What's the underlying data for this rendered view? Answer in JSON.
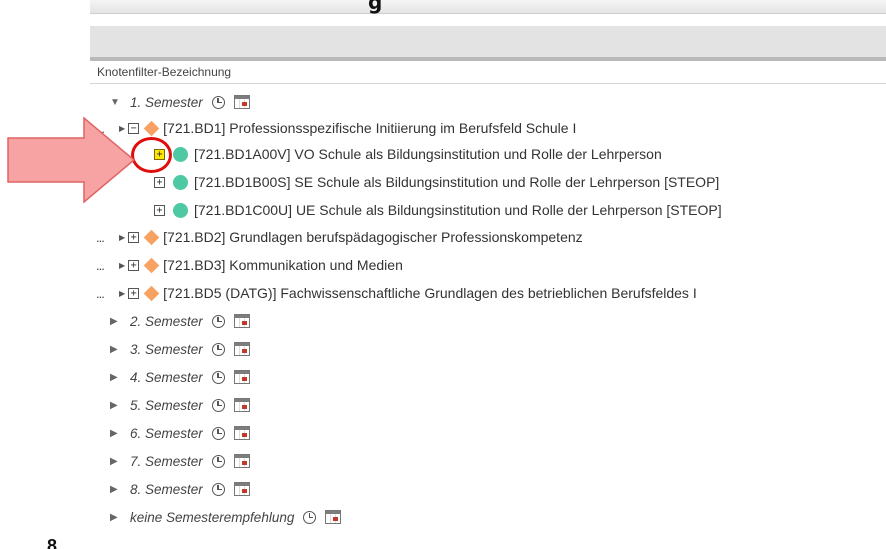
{
  "header": {
    "title_fragment": "g",
    "column_label": "Knotenfilter-Bezeichnung"
  },
  "tree": {
    "open_semester": {
      "label": "1. Semester",
      "expanded": true
    },
    "modules": [
      {
        "code": "[721.BD1] Professionsspezifische Initiierung im Berufsfeld Schule I",
        "prefix": "...",
        "toggle": "−",
        "expanded": true
      },
      {
        "code": "[721.BD2] Grundlagen berufspädagogischer Professionskompetenz",
        "prefix": "...",
        "toggle": "+"
      },
      {
        "code": "[721.BD3] Kommunikation und Medien",
        "prefix": "...",
        "toggle": "+"
      },
      {
        "code": "[721.BD5 (DATG)] Fachwissenschaftliche Grundlagen des betrieblichen Berufsfeldes I",
        "prefix": "...",
        "toggle": "+"
      }
    ],
    "courses": [
      {
        "label": "[721.BD1A00V] VO Schule als Bildungsinstitution und Rolle der Lehrperson",
        "toggle": "+",
        "highlighted": true
      },
      {
        "label": "[721.BD1B00S] SE Schule als Bildungsinstitution und Rolle der Lehrperson [STEOP]",
        "toggle": "+"
      },
      {
        "label": "[721.BD1C00U] UE Schule als Bildungsinstitution und Rolle der Lehrperson [STEOP]",
        "toggle": "+"
      }
    ],
    "collapsed_semesters": [
      "2. Semester",
      "3. Semester",
      "4. Semester",
      "5. Semester",
      "6. Semester",
      "7. Semester",
      "8. Semester",
      "keine Semesterempfehlung"
    ]
  },
  "footer": {
    "fragment": "8"
  },
  "colors": {
    "module_icon": "#f7a262",
    "course_icon": "#4fc9a4",
    "highlight_ring": "#e10c0c",
    "callout_arrow": "#f7a3a3",
    "highlight_box": "#ffe600"
  },
  "icons": {
    "expanded": "triangle-down-icon",
    "collapsed": "triangle-right-icon",
    "time": "clock-icon",
    "calendar": "calendar-icon"
  }
}
